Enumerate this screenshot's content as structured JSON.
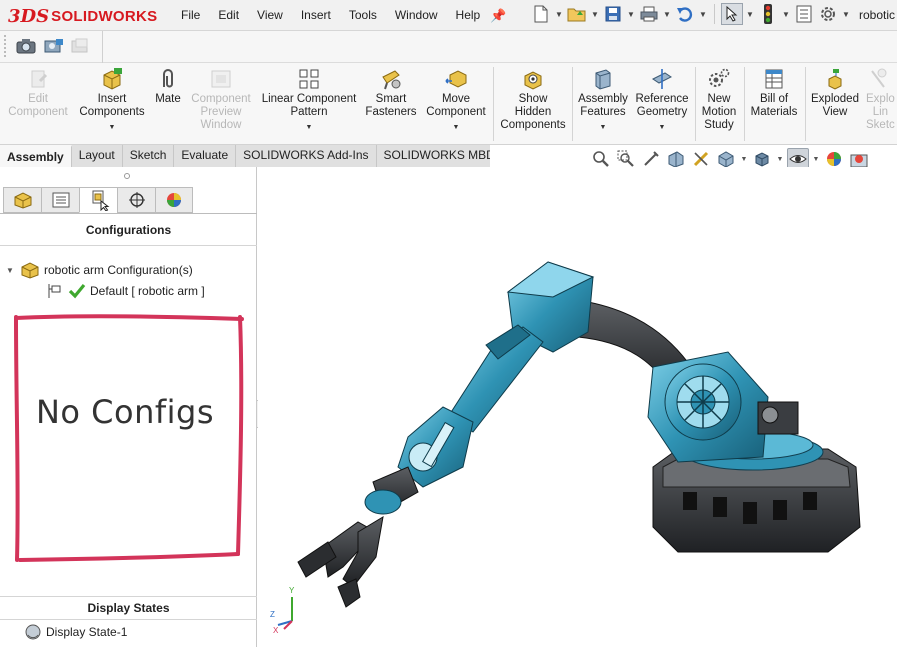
{
  "app": {
    "brand_prefix": "3DS",
    "brand": "SOLIDWORKS",
    "document_title": "robotic"
  },
  "menus": [
    "File",
    "Edit",
    "View",
    "Insert",
    "Tools",
    "Window",
    "Help"
  ],
  "ribbon": {
    "edit_component": "Edit\nComponent",
    "insert_components": "Insert\nComponents",
    "mate": "Mate",
    "component_preview_window": "Component\nPreview\nWindow",
    "linear_component_pattern": "Linear Component\nPattern",
    "smart_fasteners": "Smart\nFasteners",
    "move_component": "Move\nComponent",
    "show_hidden_components": "Show\nHidden\nComponents",
    "assembly_features": "Assembly\nFeatures",
    "reference_geometry": "Reference\nGeometry",
    "new_motion_study": "New\nMotion\nStudy",
    "bill_of_materials": "Bill of\nMaterials",
    "exploded_view": "Exploded\nView",
    "explode_line_sketch": "Explo\nLin\nSketc"
  },
  "tabs": [
    "Assembly",
    "Layout",
    "Sketch",
    "Evaluate",
    "SOLIDWORKS Add-Ins",
    "SOLIDWORKS MBD"
  ],
  "active_tab": "Assembly",
  "panel": {
    "title": "Configurations",
    "root_label": "robotic arm Configuration(s)",
    "default_config": "Default [ robotic arm ]",
    "annotation": "No Configs",
    "display_states_title": "Display States",
    "display_state_item": "Display State-1"
  },
  "triad": {
    "y": "Y",
    "z": "Z",
    "x": "X"
  },
  "colors": {
    "brand_red": "#d71920",
    "robot_blue": "#2f93b4",
    "annotation_red": "#d3345a",
    "check_green": "#3fa82f"
  },
  "icons": {
    "pin": "pin-icon",
    "camera": "camera-icon",
    "config_tab": "configuration-manager-icon"
  }
}
